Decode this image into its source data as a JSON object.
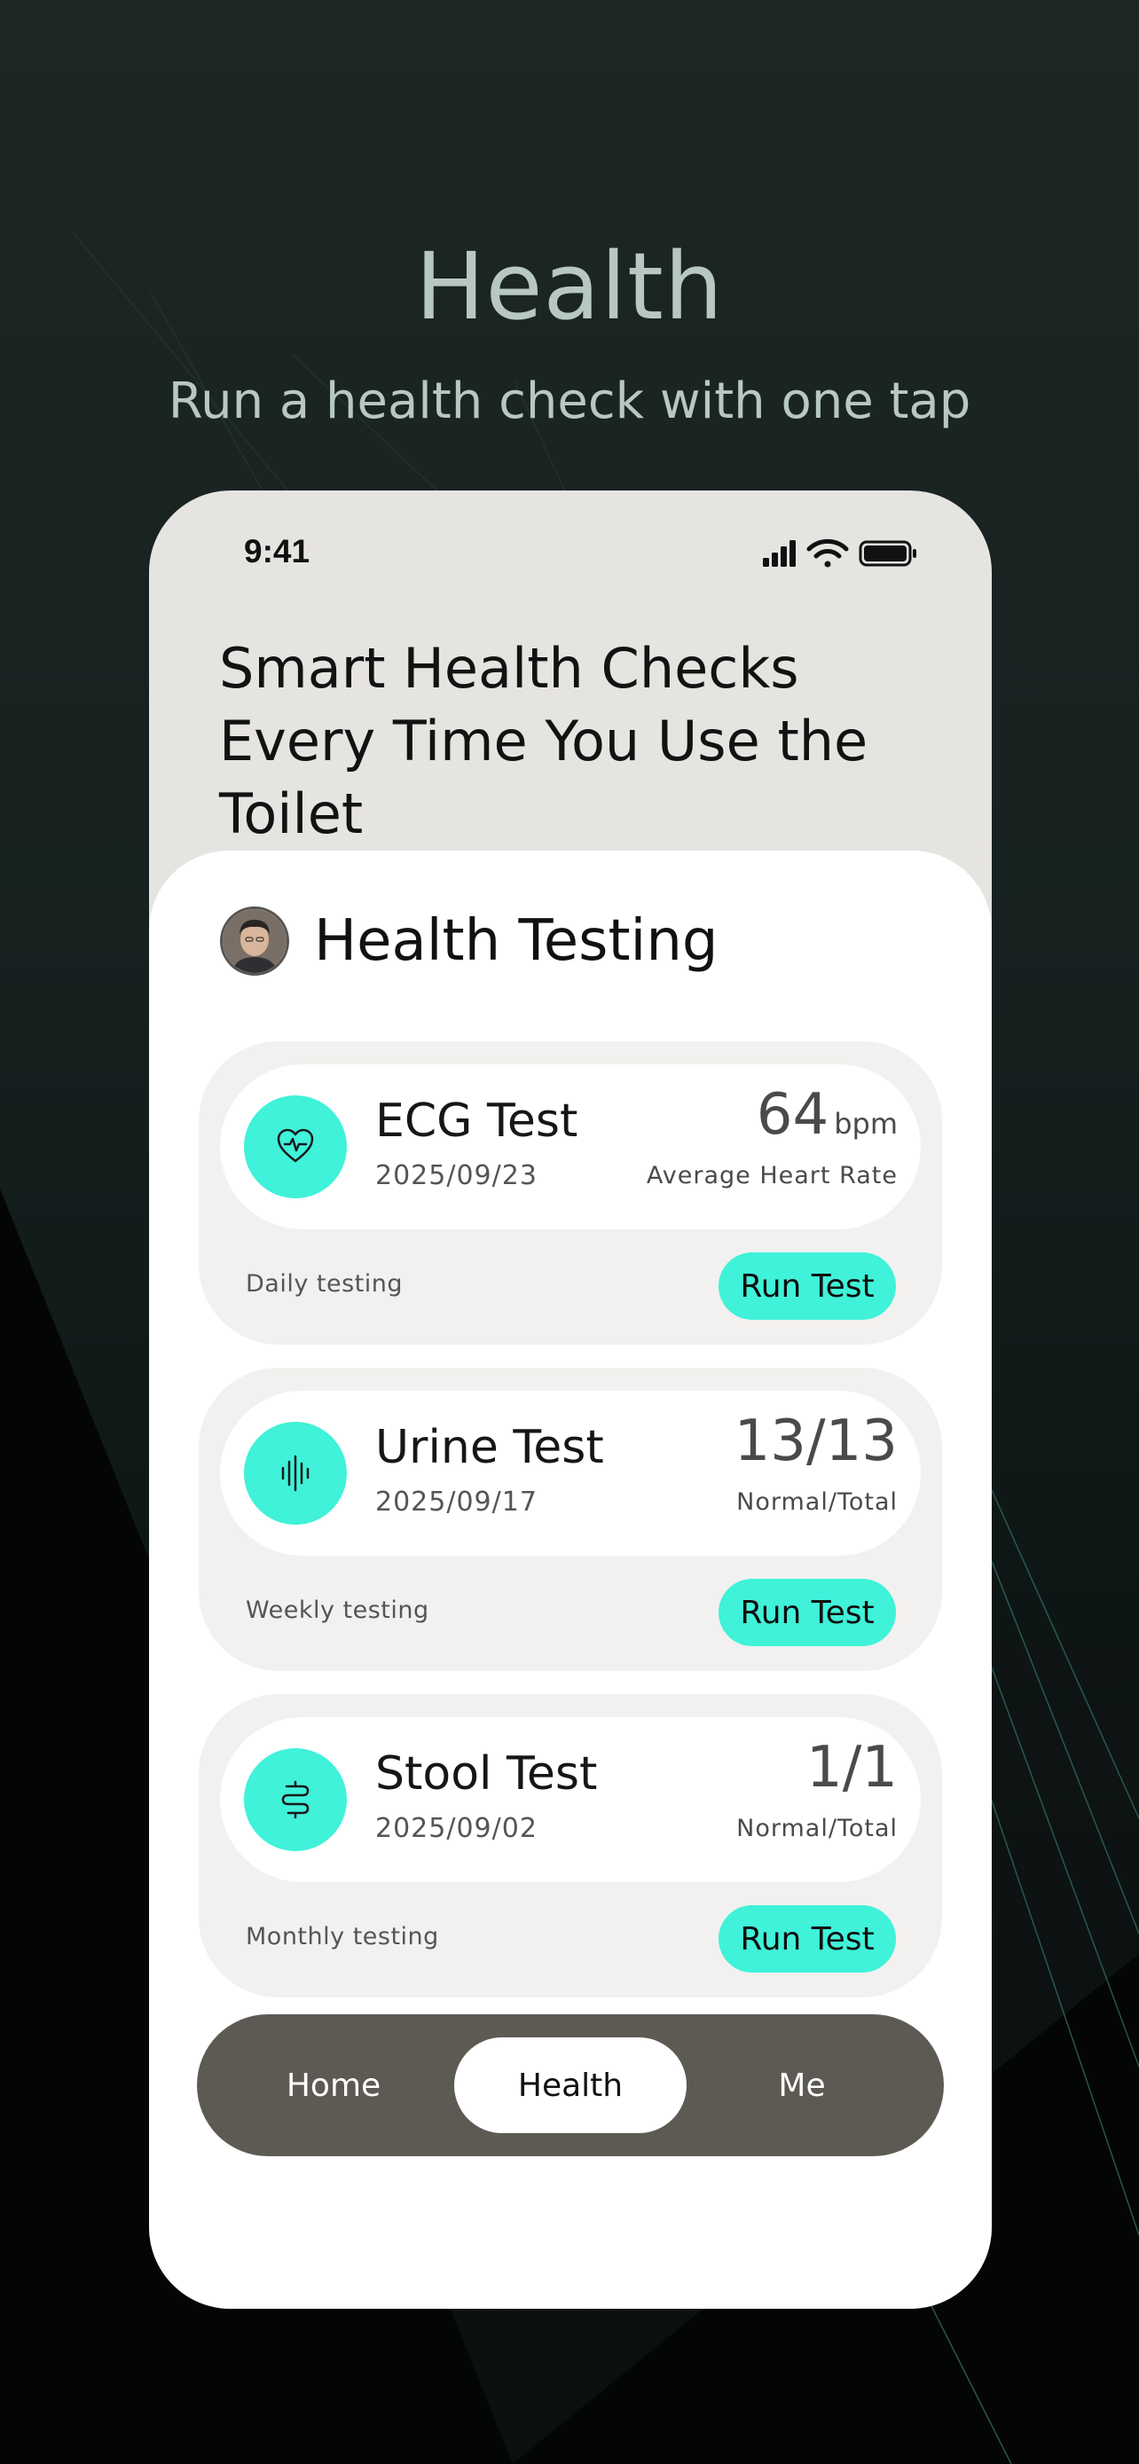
{
  "hero": {
    "title": "Health",
    "subtitle": "Run a health check with one tap"
  },
  "status_bar": {
    "time": "9:41",
    "icons": [
      "cellular-signal-icon",
      "wifi-icon",
      "battery-icon"
    ]
  },
  "phone": {
    "headline": "Smart Health Checks Every Time You Use the Toilet"
  },
  "section": {
    "title": "Health Testing"
  },
  "colors": {
    "accent": "#3ff2d9",
    "tabbar": "#5d5a54",
    "card_bg": "#f2f1ef",
    "header_bg": "#e6e4e1"
  },
  "tests": [
    {
      "name": "ECG Test",
      "date": "2025/09/23",
      "value": "64",
      "unit": "bpm",
      "value_label": "Average Heart Rate",
      "frequency": "Daily testing",
      "button": "Run Test",
      "icon": "heart-rate-icon"
    },
    {
      "name": "Urine Test",
      "date": "2025/09/17",
      "value": "13/13",
      "unit": "",
      "value_label": "Normal/Total",
      "frequency": "Weekly testing",
      "button": "Run Test",
      "icon": "waveform-icon"
    },
    {
      "name": "Stool Test",
      "date": "2025/09/02",
      "value": "1/1",
      "unit": "",
      "value_label": "Normal/Total",
      "frequency": "Monthly testing",
      "button": "Run Test",
      "icon": "intestine-icon"
    }
  ],
  "tabbar": {
    "items": [
      "Home",
      "Health",
      "Me"
    ],
    "active": "Health"
  }
}
